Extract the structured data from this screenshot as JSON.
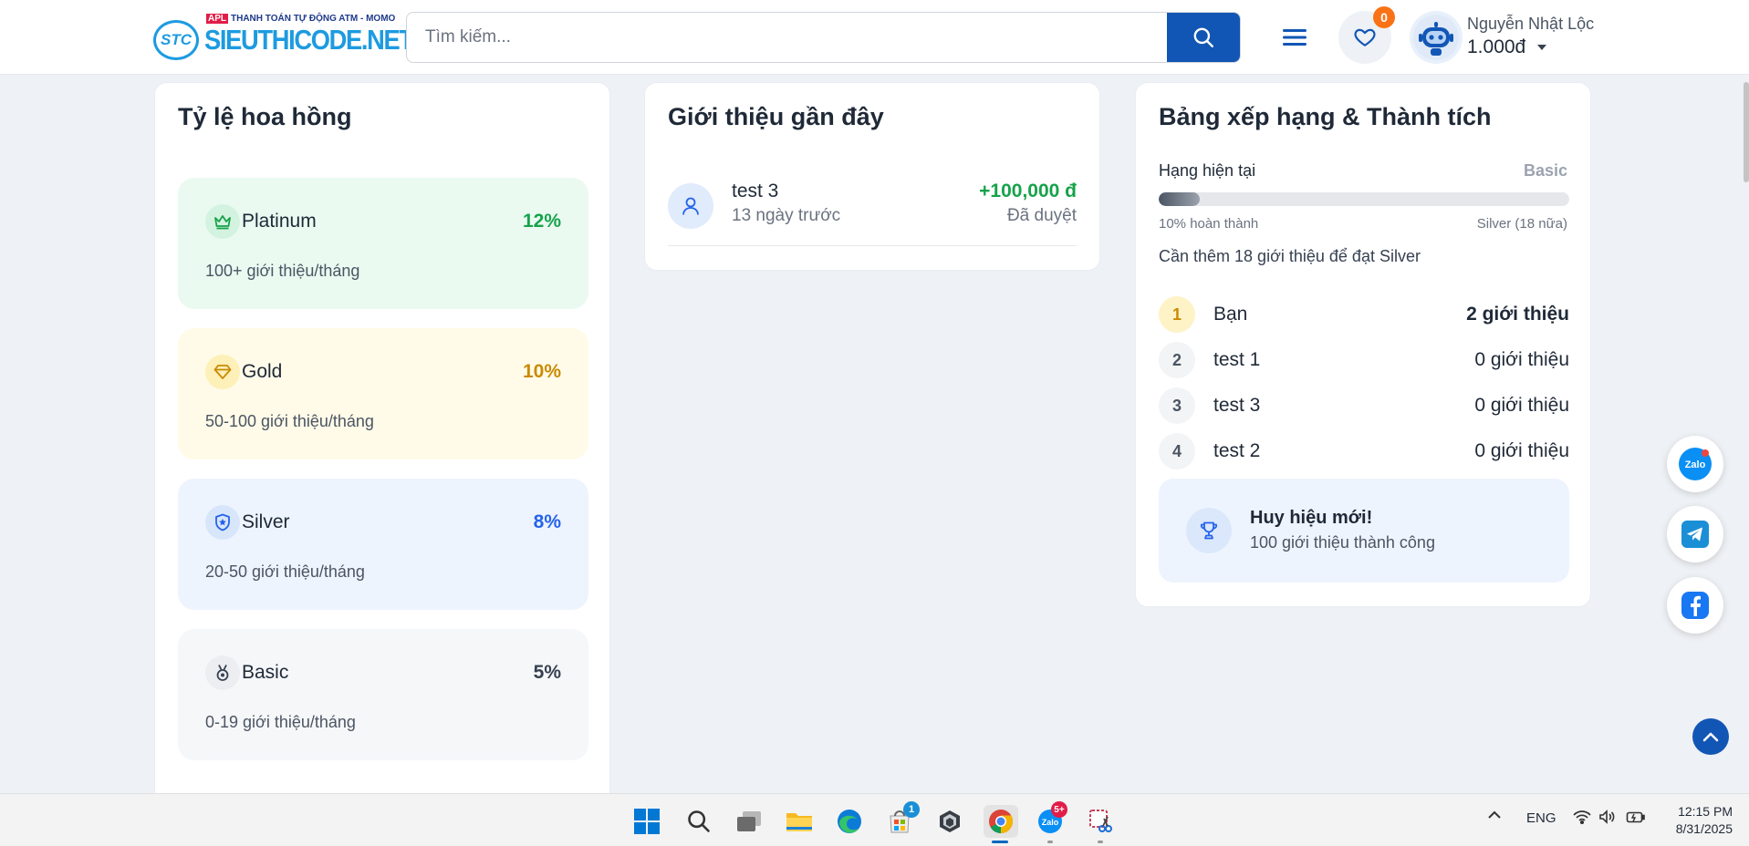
{
  "header": {
    "logo_short": "STC",
    "logo_tag_highlight": "APL",
    "logo_tag": "THANH TOÁN TỰ ĐỘNG ATM - MOMO",
    "logo_name": "SIEUTHICODE.NET",
    "search_placeholder": "Tìm kiếm...",
    "wishlist_count": "0",
    "user_name": "Nguyễn Nhật Lộc",
    "user_balance": "1.000đ"
  },
  "commission": {
    "title": "Tỷ lệ hoa hồng",
    "tiers": [
      {
        "name": "Platinum",
        "rate": "12%",
        "desc": "100+ giới thiệu/tháng",
        "color": "#16a34a",
        "bg": "#eafaf1",
        "icon": "crown-icon"
      },
      {
        "name": "Gold",
        "rate": "10%",
        "desc": "50-100 giới thiệu/tháng",
        "color": "#ca8a04",
        "bg": "#fffbe8",
        "icon": "diamond-icon"
      },
      {
        "name": "Silver",
        "rate": "8%",
        "desc": "20-50 giới thiệu/tháng",
        "color": "#2563eb",
        "bg": "#edf4fe",
        "icon": "shield-star-icon"
      },
      {
        "name": "Basic",
        "rate": "5%",
        "desc": "0-19 giới thiệu/tháng",
        "color": "#374151",
        "bg": "#f6f7f9",
        "icon": "medal-icon"
      }
    ]
  },
  "recent": {
    "title": "Giới thiệu gần đây",
    "items": [
      {
        "name": "test 3",
        "time": "13 ngày trước",
        "amount": "+100,000 đ",
        "status": "Đã duyệt"
      }
    ]
  },
  "ranking": {
    "title": "Bảng xếp hạng & Thành tích",
    "current_label": "Hạng hiện tại",
    "current_value": "Basic",
    "progress_percent": 10,
    "progress_left": "10% hoàn thành",
    "progress_right": "Silver (18 nữa)",
    "hint": "Cần thêm 18 giới thiệu để đạt Silver",
    "leaderboard": [
      {
        "rank": "1",
        "name": "Bạn",
        "count": "2 giới thiệu"
      },
      {
        "rank": "2",
        "name": "test 1",
        "count": "0 giới thiệu"
      },
      {
        "rank": "3",
        "name": "test 3",
        "count": "0 giới thiệu"
      },
      {
        "rank": "4",
        "name": "test 2",
        "count": "0 giới thiệu"
      }
    ],
    "badge_title": "Huy hiệu mới!",
    "badge_sub": "100 giới thiệu thành công"
  },
  "floating": {
    "zalo_label": "Zalo"
  },
  "taskbar": {
    "store_badge": "1",
    "zalo_badge": "5+",
    "zalo_label": "Zalo",
    "language": "ENG",
    "time": "12:15 PM",
    "date": "8/31/2025"
  }
}
